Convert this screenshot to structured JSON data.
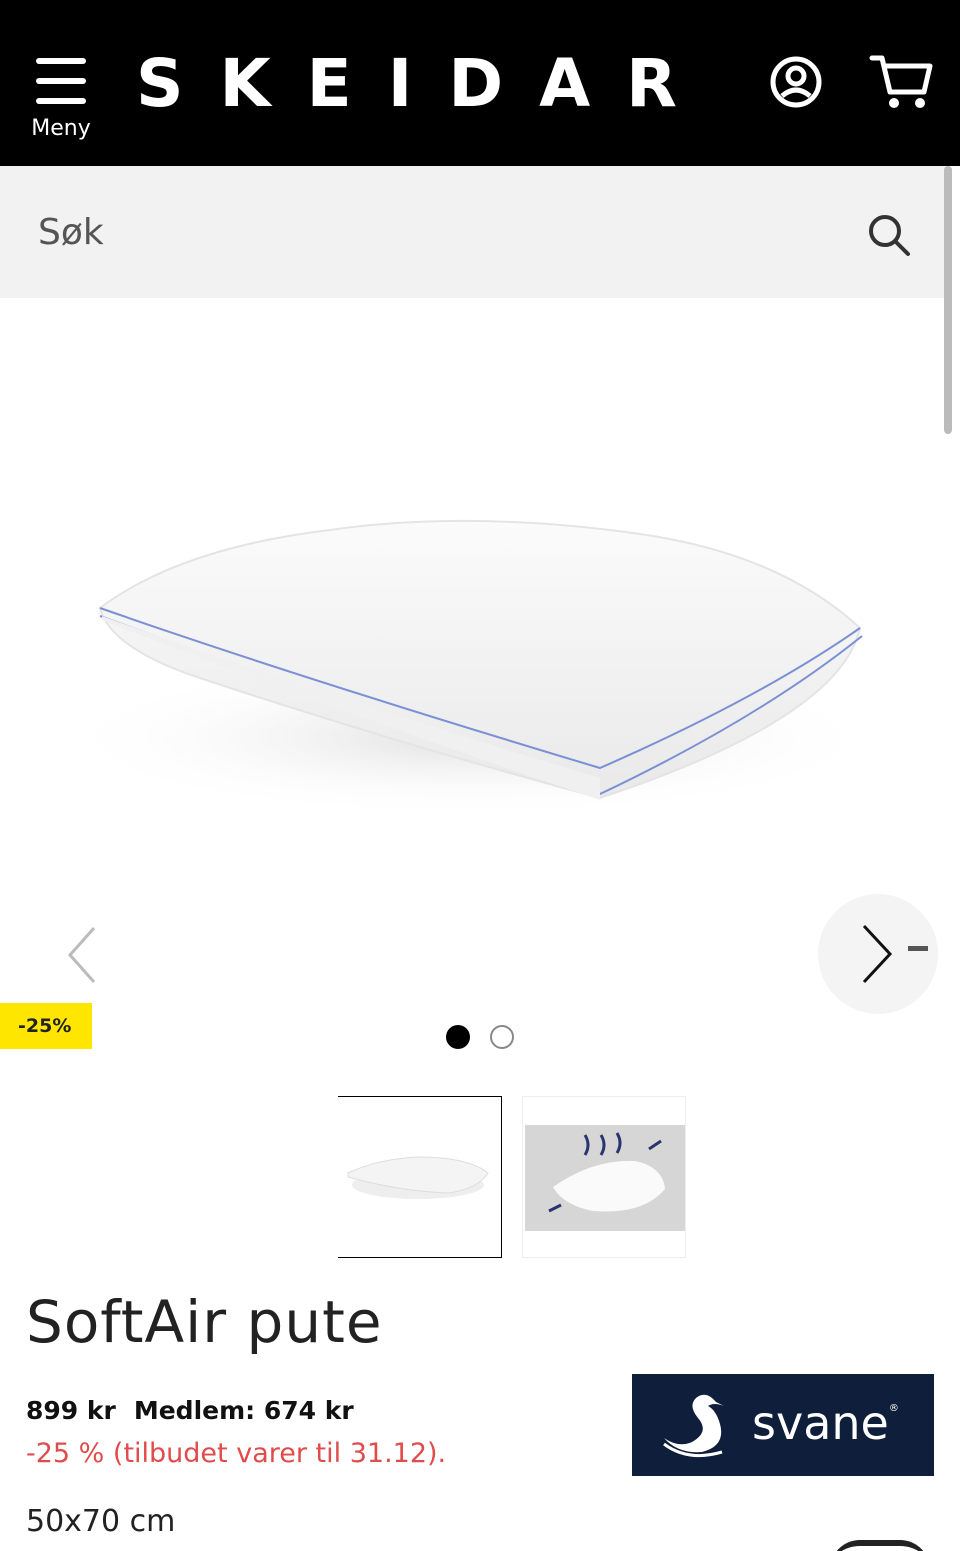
{
  "header": {
    "menu_label": "Meny",
    "logo_text": "SKEIDAR",
    "icons": {
      "menu": "hamburger-icon",
      "account": "account-icon",
      "cart": "cart-icon"
    }
  },
  "search": {
    "placeholder": "Søk",
    "icon": "search-icon"
  },
  "gallery": {
    "badge": "-25%",
    "slides_total": 2,
    "active_slide": 1
  },
  "product": {
    "title": "SoftAir pute",
    "price": "899 kr",
    "member_price": "Medlem: 674 kr",
    "offer_text": "-25 % (tilbudet varer til 31.12).",
    "size": "50x70 cm",
    "brand": "svane",
    "brand_mark": "®"
  },
  "colors": {
    "header_bg": "#000000",
    "badge_bg": "#ffe600",
    "offer_red": "#e04b4b",
    "brand_navy": "#0f1e3a"
  }
}
